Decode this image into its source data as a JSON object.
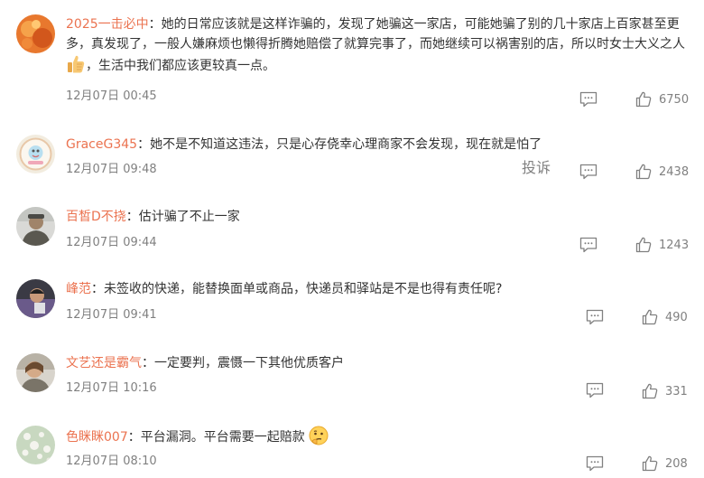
{
  "comments": [
    {
      "username": "2025一击必中",
      "colon": "：",
      "text_part1": "她的日常应该就是这样诈骗的，发现了她骗这一家店，可能她骗了别的几十家店上百家甚至更多，真发现了，一般人嫌麻烦也懒得折腾她赔偿了就算完事了，而她继续可以祸害别的店，所以时女士大义之人",
      "emoji_icon": "thumbs-up-emoji",
      "text_part2": "，生活中我们都应该更较真一点。",
      "time": "12月07日 00:45",
      "likes": "6750"
    },
    {
      "username": "GraceG345",
      "colon": "：",
      "text": "她不是不知道这违法，只是心存侥幸心理商家不会发现，现在就是怕了",
      "time": "12月07日 09:48",
      "report": "投诉",
      "likes": "2438"
    },
    {
      "username": "百皙D不挠",
      "colon": "：",
      "text": "估计骗了不止一家",
      "time": "12月07日 09:44",
      "likes": "1243"
    },
    {
      "username": "峰范",
      "colon": "：",
      "text": "未签收的快递，能替换面单或商品，快递员和驿站是不是也得有责任呢?",
      "time": "12月07日 09:41",
      "likes": "490"
    },
    {
      "username": "文艺还是霸气",
      "colon": "：",
      "text": "一定要判，震慑一下其他优质客户",
      "time": "12月07日 10:16",
      "likes": "331"
    },
    {
      "username": "色眯眯007",
      "colon": "：",
      "text": "平台漏洞。平台需要一起赔款",
      "emoji_icon": "thinking-face-emoji",
      "time": "12月07日 08:10",
      "likes": "208"
    }
  ],
  "icons": {
    "reply": "comment-icon",
    "like": "thumbs-up-icon"
  },
  "colors": {
    "username": "#eb7350",
    "text": "#333333",
    "meta": "#808080"
  }
}
